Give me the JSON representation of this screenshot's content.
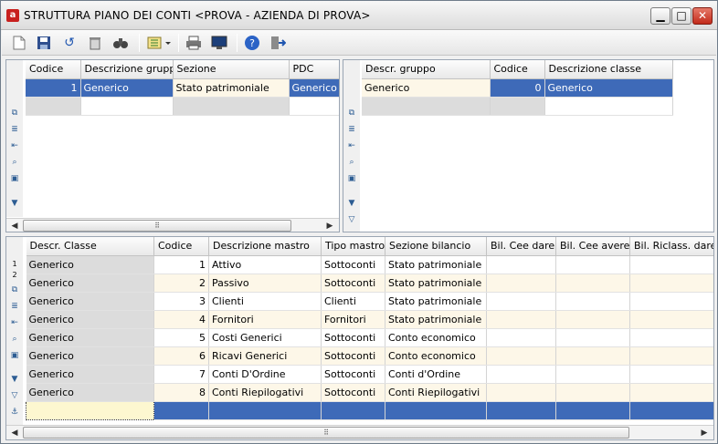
{
  "window": {
    "title": "STRUTTURA PIANO DEI CONTI <PROVA - AZIENDA DI PROVA>",
    "app_icon": "app-icon",
    "controls": {
      "minimize": "▁",
      "maximize": "□",
      "close": "✕"
    }
  },
  "toolbar": {
    "icons": [
      "new-document-icon",
      "save-icon",
      "undo-icon",
      "delete-icon",
      "find-icon",
      "list-view-icon",
      "print-icon",
      "monitor-icon",
      "help-icon",
      "exit-icon"
    ]
  },
  "groups": {
    "columns": [
      "Codice",
      "Descrizione gruppo",
      "Sezione",
      "PDC"
    ],
    "rows": [
      {
        "codice": "1",
        "descrizione": "Generico",
        "sezione": "Stato patrimoniale",
        "pdc": "Generico"
      }
    ]
  },
  "classes": {
    "columns": [
      "Descr. gruppo",
      "Codice",
      "Descrizione classe"
    ],
    "rows": [
      {
        "gruppo": "Generico",
        "codice": "0",
        "descrizione": "Generico"
      }
    ]
  },
  "mastri": {
    "columns": [
      "Descr. Classe",
      "Codice",
      "Descrizione mastro",
      "Tipo mastro",
      "Sezione bilancio",
      "Bil. Cee dare",
      "Bil. Cee avere",
      "Bil. Riclass. dare"
    ],
    "row_markers": [
      "1",
      "2"
    ],
    "rows": [
      {
        "classe": "Generico",
        "codice": "1",
        "descrizione": "Attivo",
        "tipo": "Sottoconti",
        "sezione": "Stato patrimoniale"
      },
      {
        "classe": "Generico",
        "codice": "2",
        "descrizione": "Passivo",
        "tipo": "Sottoconti",
        "sezione": "Stato patrimoniale"
      },
      {
        "classe": "Generico",
        "codice": "3",
        "descrizione": "Clienti",
        "tipo": "Clienti",
        "sezione": "Stato patrimoniale"
      },
      {
        "classe": "Generico",
        "codice": "4",
        "descrizione": "Fornitori",
        "tipo": "Fornitori",
        "sezione": "Stato patrimoniale"
      },
      {
        "classe": "Generico",
        "codice": "5",
        "descrizione": "Costi Generici",
        "tipo": "Sottoconti",
        "sezione": "Conto economico"
      },
      {
        "classe": "Generico",
        "codice": "6",
        "descrizione": "Ricavi Generici",
        "tipo": "Sottoconti",
        "sezione": "Conto economico"
      },
      {
        "classe": "Generico",
        "codice": "7",
        "descrizione": "Conti D'Ordine",
        "tipo": "Sottoconti",
        "sezione": "Conti d'Ordine"
      },
      {
        "classe": "Generico",
        "codice": "8",
        "descrizione": "Conti Riepilogativi",
        "tipo": "Sottoconti",
        "sezione": "Conti Riepilogativi"
      }
    ]
  },
  "side_icons": [
    "copy-icon",
    "list-icon",
    "insert-icon",
    "zoom-icon",
    "form-icon",
    "filter-icon",
    "filter-remove-icon",
    "anchor-icon"
  ],
  "colors": {
    "selection": "#3e6ab8",
    "alt_row": "#fdf7e8"
  }
}
